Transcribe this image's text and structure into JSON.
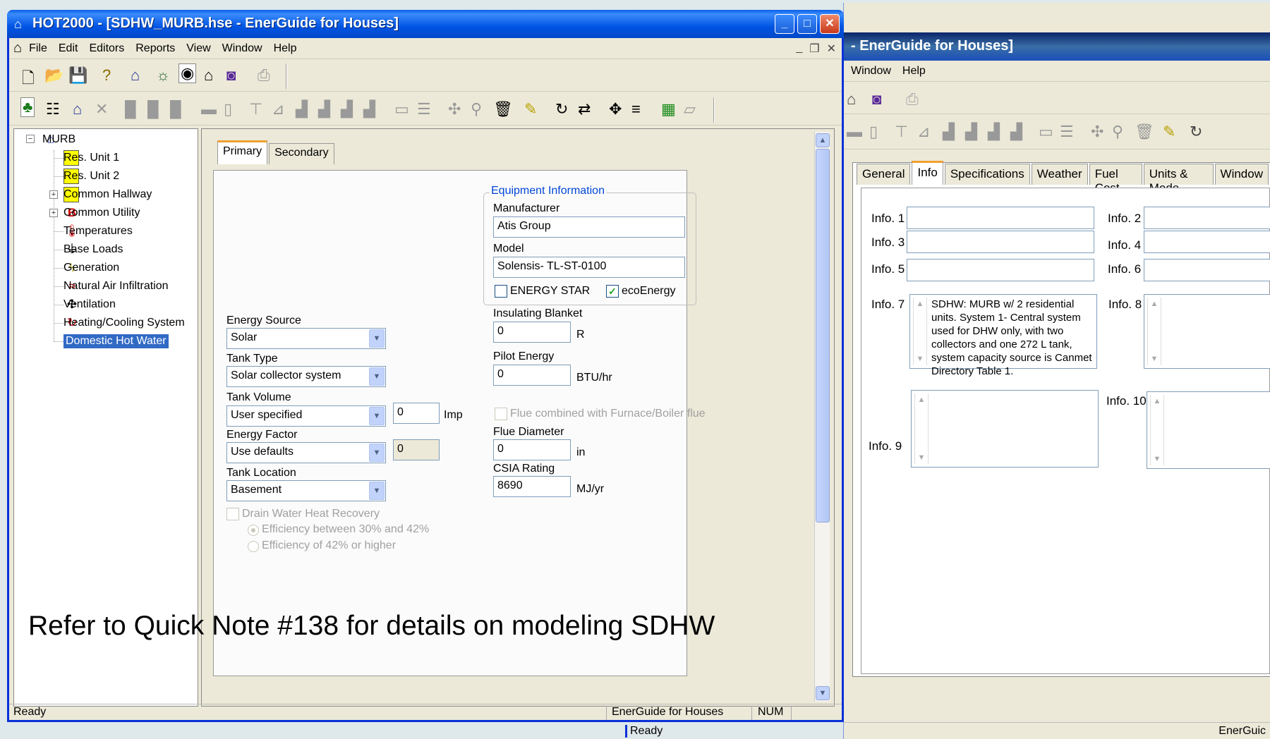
{
  "main_window": {
    "title": "HOT2000 - [SDHW_MURB.hse - EnerGuide for Houses]",
    "menu": [
      "File",
      "Edit",
      "Editors",
      "Reports",
      "View",
      "Window",
      "Help"
    ]
  },
  "tree": {
    "root": "MURB",
    "items": [
      {
        "label": "Res. Unit 1",
        "icon": "unit-icon"
      },
      {
        "label": "Res. Unit 2",
        "icon": "unit-icon"
      },
      {
        "label": "Common Hallway",
        "icon": "unit-icon"
      },
      {
        "label": "Common Utility",
        "icon": "utility-icon"
      },
      {
        "label": "Temperatures",
        "icon": "thermometer-icon"
      },
      {
        "label": "Base Loads",
        "icon": "plug-icon"
      },
      {
        "label": "Generation",
        "icon": "lightning-icon"
      },
      {
        "label": "Natural Air Infiltration",
        "icon": "air-wave-icon"
      },
      {
        "label": "Ventilation",
        "icon": "fan-icon"
      },
      {
        "label": "Heating/Cooling System",
        "icon": "cycle-icon"
      },
      {
        "label": "Domestic Hot Water",
        "icon": "faucet-icon"
      }
    ]
  },
  "tabs": {
    "primary": "Primary",
    "secondary": "Secondary"
  },
  "form": {
    "equipment_legend": "Equipment Information",
    "manufacturer_label": "Manufacturer",
    "manufacturer_value": "Atis Group",
    "model_label": "Model",
    "model_value": "Solensis- TL-ST-0100",
    "energy_star_label": "ENERGY STAR",
    "eco_energy_label": "ecoEnergy",
    "energy_source_label": "Energy Source",
    "energy_source_value": "Solar",
    "tank_type_label": "Tank Type",
    "tank_type_value": "Solar collector system",
    "tank_volume_label": "Tank Volume",
    "tank_volume_value": "User specified",
    "tank_volume_num": "0",
    "tank_volume_unit": "Imp",
    "energy_factor_label": "Energy Factor",
    "energy_factor_value": "Use defaults",
    "energy_factor_num": "0",
    "tank_location_label": "Tank Location",
    "tank_location_value": "Basement",
    "insulating_label": "Insulating Blanket",
    "insulating_value": "0",
    "insulating_unit": "R",
    "pilot_label": "Pilot Energy",
    "pilot_value": "0",
    "pilot_unit": "BTU/hr",
    "flue_combined_label": "Flue combined with Furnace/Boiler flue",
    "flue_diameter_label": "Flue Diameter",
    "flue_diameter_value": "0",
    "flue_diameter_unit": "in",
    "csia_label": "CSIA Rating",
    "csia_value": "8690",
    "csia_unit": "MJ/yr",
    "drain_label": "Drain Water Heat Recovery",
    "eff1_label": "Efficiency between 30% and 42%",
    "eff2_label": "Efficiency of 42% or higher"
  },
  "note": "Refer to Quick Note #138 for details on modeling SDHW",
  "status": {
    "left": "Ready",
    "middle": "EnerGuide for Houses",
    "right": "NUM"
  },
  "bg_window": {
    "title": "- EnerGuide for Houses]",
    "menu": [
      "Window",
      "Help"
    ],
    "tabs": [
      "General",
      "Info",
      "Specifications",
      "Weather",
      "Fuel Cost",
      "Units & Mode",
      "Window"
    ],
    "info_labels": [
      "Info. 1",
      "Info. 2",
      "Info. 3",
      "Info. 4",
      "Info. 5",
      "Info. 6",
      "Info. 7",
      "Info. 8",
      "Info. 9",
      "Info. 10"
    ],
    "info7_text": "SDHW: MURB w/ 2 residential units. System 1-  Central system used for DHW only, with two collectors and one 272 L tank, system capacity source is  Canmet Directory Table 1.",
    "status_left": "Ready",
    "status_right": "EnerGuic"
  }
}
